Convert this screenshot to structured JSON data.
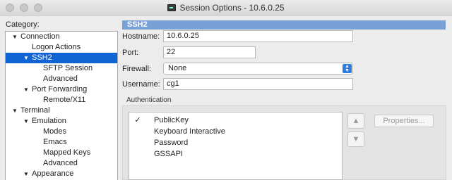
{
  "window": {
    "title": "Session Options - 10.6.0.25",
    "app_icon": "terminal-icon"
  },
  "category": {
    "label": "Category:",
    "items": [
      {
        "label": "Connection",
        "expanded": true
      },
      {
        "label": "Logon Actions"
      },
      {
        "label": "SSH2",
        "expanded": true,
        "selected": true
      },
      {
        "label": "SFTP Session"
      },
      {
        "label": "Advanced"
      },
      {
        "label": "Port Forwarding",
        "expanded": true
      },
      {
        "label": "Remote/X11"
      },
      {
        "label": "Terminal",
        "expanded": true
      },
      {
        "label": "Emulation",
        "expanded": true
      },
      {
        "label": "Modes"
      },
      {
        "label": "Emacs"
      },
      {
        "label": "Mapped Keys"
      },
      {
        "label": "Advanced"
      },
      {
        "label": "Appearance",
        "expanded": true
      }
    ]
  },
  "panel": {
    "header": "SSH2",
    "hostname": {
      "label": "Hostname:",
      "value": "10.6.0.25"
    },
    "port": {
      "label": "Port:",
      "value": "22"
    },
    "firewall": {
      "label": "Firewall:",
      "value": "None"
    },
    "username": {
      "label": "Username:",
      "value": "cg1"
    },
    "authentication": {
      "label": "Authentication",
      "items": [
        {
          "label": "PublicKey",
          "checked": true
        },
        {
          "label": "Keyboard Interactive",
          "checked": false
        },
        {
          "label": "Password",
          "checked": false
        },
        {
          "label": "GSSAPI",
          "checked": false
        }
      ],
      "check_glyph": "✓",
      "move_up_icon": "▲",
      "move_down_icon": "▼",
      "properties_label": "Properties..."
    }
  }
}
